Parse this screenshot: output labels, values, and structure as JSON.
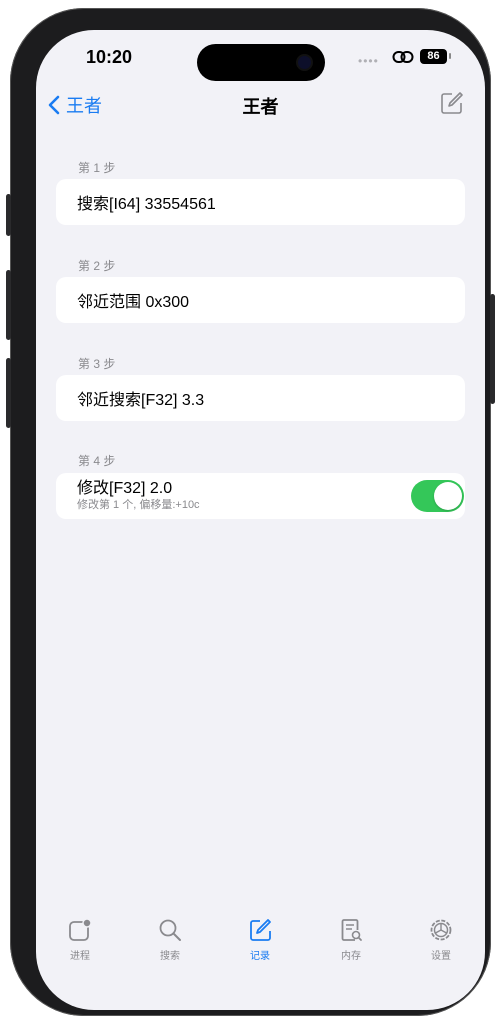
{
  "status": {
    "time": "10:20",
    "battery": "86"
  },
  "nav": {
    "back_label": "王者",
    "title": "王者"
  },
  "steps": [
    {
      "label": "第 1 步",
      "text": "搜索[I64] 33554561"
    },
    {
      "label": "第 2 步",
      "text": "邻近范围 0x300"
    },
    {
      "label": "第 3 步",
      "text": "邻近搜索[F32] 3.3"
    },
    {
      "label": "第 4 步",
      "text": "修改[F32] 2.0",
      "subtext": "修改第 1 个, 偏移量:+10c",
      "enabled": true
    }
  ],
  "tabs": [
    {
      "label": "进程",
      "icon": "process-icon"
    },
    {
      "label": "搜索",
      "icon": "search-icon"
    },
    {
      "label": "记录",
      "icon": "record-icon",
      "active": true
    },
    {
      "label": "内存",
      "icon": "memory-icon"
    },
    {
      "label": "设置",
      "icon": "settings-icon"
    }
  ],
  "colors": {
    "accent": "#1a7cf2",
    "toggle_on": "#34c759",
    "background": "#f2f2f7"
  }
}
